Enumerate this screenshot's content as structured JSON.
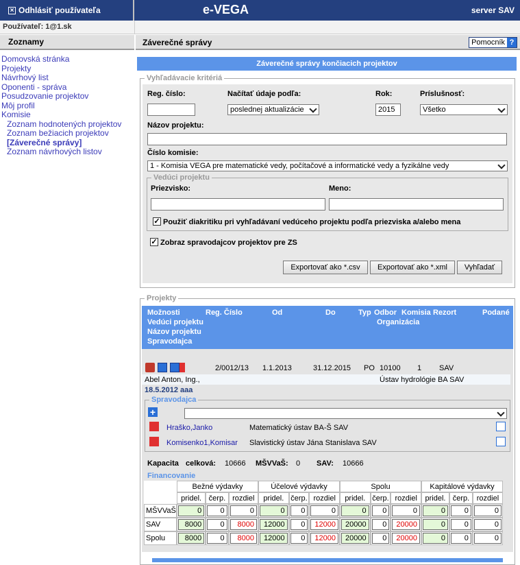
{
  "header": {
    "logout_label": "Odhlásiť používateľa",
    "app_title": "e-VEGA",
    "server_label": "server SAV",
    "user_label": "Používateľ: 1@1.sk"
  },
  "menu": {
    "title": "Zoznamy",
    "items": [
      {
        "label": "Domovská stránka"
      },
      {
        "label": "Projekty"
      },
      {
        "label": "Návrhový list"
      },
      {
        "label": "Oponenti - správa"
      },
      {
        "label": "Posudzovanie projektov"
      },
      {
        "label": "Môj profil"
      },
      {
        "label": "Komisie"
      }
    ],
    "subitems": [
      {
        "label": "Zoznam hodnotených projektov"
      },
      {
        "label": "Zoznam bežiacich projektov"
      },
      {
        "label": "[Záverečné správy]"
      },
      {
        "label": "Zoznam návrhových listov"
      }
    ]
  },
  "page": {
    "title": "Záverečné správy",
    "help_label": "Pomocník",
    "help_icon": "?",
    "banner": "Záverečné správy končiacich projektov"
  },
  "search": {
    "legend": "Vyhľadávacie kritériá",
    "reg_label": "Reg. číslo:",
    "reg_value": "",
    "load_label": "Načítať údaje podľa:",
    "load_value": "poslednej aktualizácie",
    "year_label": "Rok:",
    "year_value": "2015",
    "belong_label": "Príslušnosť:",
    "belong_value": "Všetko",
    "name_label": "Názov projektu:",
    "name_value": "",
    "committee_label": "Číslo komisie:",
    "committee_value": "1 - Komisia VEGA pre matematické vedy, počítačové a informatické vedy a fyzikálne vedy",
    "leader_legend": "Vedúci projektu",
    "surname_label": "Priezvisko:",
    "surname_value": "",
    "firstname_label": "Meno:",
    "firstname_value": "",
    "diacritics_label": "Použiť diakritiku pri vyhľadávaní vedúceho projektu podľa priezviska a/alebo mena",
    "diacritics_checked": true,
    "show_reporters_label": "Zobraz spravodajcov projektov pre ZS",
    "show_reporters_checked": true,
    "export_csv_label": "Exportovať ako *.csv",
    "export_xml_label": "Exportovať ako *.xml",
    "search_label": "Vyhľadať"
  },
  "projects": {
    "legend": "Projekty",
    "headers": {
      "options": "Možnosti",
      "reg": "Reg. Číslo",
      "from": "Od",
      "to": "Do",
      "type": "Typ",
      "field": "Odbor",
      "committee": "Komisia",
      "department": "Rezort",
      "submitted": "Podané",
      "leader": "Vedúci projektu",
      "organization": "Organizácia",
      "name": "Názov projektu",
      "reporter": "Spravodajca"
    },
    "row": {
      "reg": "2/0012/13",
      "from": "1.1.2013",
      "to": "31.12.2015",
      "type": "PO",
      "field": "10100",
      "committee": "1",
      "department": "SAV",
      "leader": "Abel Anton, Ing.,",
      "organization": "Ústav hydrológie BA SAV",
      "name_line": "18.5.2012 aaa"
    },
    "reporters_legend": "Spravodajca",
    "reporter_select_value": "",
    "reporters": [
      {
        "name": "Hraško,Janko",
        "org": "Matematický ústav BA-Š SAV"
      },
      {
        "name": "Komisenko1,Komisar",
        "org": "Slavistický ústav Jána Stanislava SAV"
      }
    ],
    "capacity": {
      "label": "Kapacita",
      "total_label": "celková:",
      "total_value": "10666",
      "msvvas_label": "MŠVVaŠ:",
      "msvvas_value": "0",
      "sav_label": "SAV:",
      "sav_value": "10666"
    },
    "finance": {
      "legend": "Financovanie",
      "groups": [
        "Bežné výdavky",
        "Účelové výdavky",
        "Spolu",
        "Kapitálové výdavky"
      ],
      "subcols": [
        "pridel.",
        "čerp.",
        "rozdiel"
      ],
      "rows": [
        {
          "label": "MŠVVaŠ",
          "values": [
            "0",
            "0",
            "0",
            "0",
            "0",
            "0",
            "0",
            "0",
            "0",
            "0",
            "0",
            "0"
          ]
        },
        {
          "label": "SAV",
          "values": [
            "8000",
            "0",
            "8000",
            "12000",
            "0",
            "12000",
            "20000",
            "0",
            "20000",
            "0",
            "0",
            "0"
          ]
        },
        {
          "label": "Spolu",
          "values": [
            "8000",
            "0",
            "8000",
            "12000",
            "0",
            "12000",
            "20000",
            "0",
            "20000",
            "0",
            "0",
            "0"
          ]
        }
      ]
    }
  }
}
